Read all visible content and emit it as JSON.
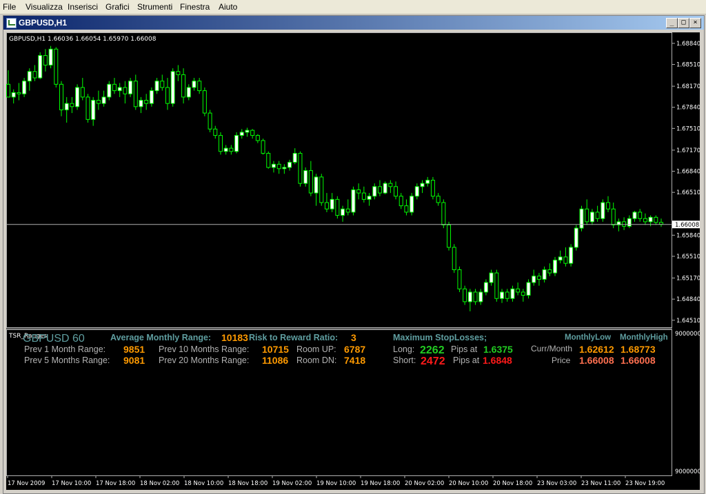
{
  "menu": {
    "items": [
      "File",
      "Visualizza",
      "Inserisci",
      "Grafici",
      "Strumenti",
      "Finestra",
      "Aiuto"
    ]
  },
  "window": {
    "title": "GBPUSD,H1",
    "btn_min": "_",
    "btn_max": "□",
    "btn_close": "×"
  },
  "chart": {
    "header": "GBPUSD,H1  1.66036 1.66054 1.65970 1.66008",
    "current_price_label": "1.66008",
    "price_ticks": [
      "1.68840",
      "1.68510",
      "1.68170",
      "1.67840",
      "1.67510",
      "1.67170",
      "1.66840",
      "1.66510",
      "1.65840",
      "1.65510",
      "1.65170",
      "1.64840",
      "1.64510"
    ],
    "time_ticks": [
      "17 Nov 2009",
      "17 Nov 10:00",
      "17 Nov 18:00",
      "18 Nov 02:00",
      "18 Nov 10:00",
      "18 Nov 18:00",
      "19 Nov 02:00",
      "19 Nov 10:00",
      "19 Nov 18:00",
      "20 Nov 02:00",
      "20 Nov 10:00",
      "20 Nov 18:00",
      "23 Nov 03:00",
      "23 Nov 11:00",
      "23 Nov 19:00"
    ],
    "sub_ticks": [
      "9000000",
      "9000000"
    ],
    "colors": {
      "bg": "#000000",
      "bull": "#ffffff",
      "bear": "#000000",
      "wick": "#00ff00",
      "grid": "#b0b0b0"
    }
  },
  "indicator": {
    "name": "TSR_Ranges",
    "pair_label": "GBPUSD 60",
    "avg_label": "Average Monthly Range:",
    "avg_value": "10183",
    "rr_label": "Risk to Reward Ratio:",
    "rr_value": "3",
    "prev1_label": "Prev 1 Month Range:",
    "prev1_value": "9851",
    "prev5_label": "Prev 5 Months Range:",
    "prev5_value": "9081",
    "prev10_label": "Prev 10 Months Range:",
    "prev10_value": "10715",
    "prev20_label": "Prev 20 Months Range:",
    "prev20_value": "11086",
    "roomup_label": "Room UP:",
    "roomup_value": "6787",
    "roomdn_label": "Room DN:",
    "roomdn_value": "7418",
    "maxsl_label": "Maximum StopLosses;",
    "long_label": "Long:",
    "long_value": "2262",
    "long_pips": "Pips at",
    "long_price": "1.6375",
    "short_label": "Short:",
    "short_value": "2472",
    "short_pips": "Pips at",
    "short_price": "1.6848",
    "mlow_label": "MonthlyLow",
    "mhigh_label": "MonthlyHigh",
    "currmonth_label": "Curr/Month",
    "currmonth_low": "1.62612",
    "currmonth_high": "1.68773",
    "price_label": "Price",
    "price_low": "1.66008",
    "price_high": "1.66008",
    "colors": {
      "orange": "#ff9a00",
      "green": "#22cc22",
      "red": "#ff1a1a",
      "teal": "#5f9ea0",
      "salmon": "#ff7050"
    }
  },
  "chart_data": {
    "type": "candlestick",
    "symbol": "GBPUSD,H1",
    "ylim": [
      1.644,
      1.6899
    ],
    "candles": [
      [
        1.682,
        1.6842,
        1.68,
        1.68
      ],
      [
        1.68,
        1.6812,
        1.679,
        1.6807
      ],
      [
        1.6807,
        1.6822,
        1.6795,
        1.6805
      ],
      [
        1.6805,
        1.683,
        1.68,
        1.6825
      ],
      [
        1.6825,
        1.6845,
        1.681,
        1.684
      ],
      [
        1.684,
        1.685,
        1.6825,
        1.683
      ],
      [
        1.683,
        1.687,
        1.6828,
        1.6865
      ],
      [
        1.6865,
        1.6875,
        1.684,
        1.685
      ],
      [
        1.685,
        1.688,
        1.6845,
        1.6875
      ],
      [
        1.6875,
        1.6878,
        1.6815,
        1.682
      ],
      [
        1.682,
        1.6825,
        1.677,
        1.678
      ],
      [
        1.678,
        1.68,
        1.676,
        1.679
      ],
      [
        1.679,
        1.68,
        1.6775,
        1.6785
      ],
      [
        1.6785,
        1.682,
        1.678,
        1.6815
      ],
      [
        1.6815,
        1.683,
        1.6795,
        1.68
      ],
      [
        1.68,
        1.6805,
        1.676,
        1.6765
      ],
      [
        1.6765,
        1.68,
        1.6755,
        1.6795
      ],
      [
        1.6795,
        1.681,
        1.678,
        1.679
      ],
      [
        1.679,
        1.681,
        1.6785,
        1.68
      ],
      [
        1.68,
        1.6825,
        1.6795,
        1.682
      ],
      [
        1.682,
        1.683,
        1.6805,
        1.681
      ],
      [
        1.681,
        1.6822,
        1.68,
        1.6815
      ],
      [
        1.6815,
        1.6825,
        1.679,
        1.6805
      ],
      [
        1.6805,
        1.683,
        1.68,
        1.6825
      ],
      [
        1.6825,
        1.6835,
        1.678,
        1.6785
      ],
      [
        1.6785,
        1.68,
        1.6775,
        1.6795
      ],
      [
        1.6795,
        1.6805,
        1.678,
        1.679
      ],
      [
        1.679,
        1.6815,
        1.6785,
        1.681
      ],
      [
        1.681,
        1.683,
        1.6805,
        1.6825
      ],
      [
        1.6825,
        1.6835,
        1.681,
        1.6815
      ],
      [
        1.6815,
        1.683,
        1.678,
        1.679
      ],
      [
        1.679,
        1.6845,
        1.6785,
        1.684
      ],
      [
        1.684,
        1.685,
        1.6825,
        1.6835
      ],
      [
        1.6835,
        1.6845,
        1.679,
        1.68
      ],
      [
        1.68,
        1.682,
        1.6795,
        1.6815
      ],
      [
        1.6815,
        1.683,
        1.681,
        1.6825
      ],
      [
        1.6825,
        1.683,
        1.6805,
        1.681
      ],
      [
        1.681,
        1.6815,
        1.677,
        1.6775
      ],
      [
        1.6775,
        1.678,
        1.6745,
        1.675
      ],
      [
        1.675,
        1.6755,
        1.6735,
        1.674
      ],
      [
        1.674,
        1.6745,
        1.671,
        1.6715
      ],
      [
        1.6715,
        1.6725,
        1.671,
        1.672
      ],
      [
        1.672,
        1.6725,
        1.671,
        1.6715
      ],
      [
        1.6715,
        1.6745,
        1.6712,
        1.674
      ],
      [
        1.674,
        1.675,
        1.6735,
        1.6745
      ],
      [
        1.6745,
        1.6752,
        1.6738,
        1.6748
      ],
      [
        1.6748,
        1.675,
        1.6735,
        1.674
      ],
      [
        1.674,
        1.6742,
        1.6728,
        1.6732
      ],
      [
        1.6732,
        1.6735,
        1.671,
        1.6712
      ],
      [
        1.6712,
        1.6715,
        1.6688,
        1.669
      ],
      [
        1.669,
        1.67,
        1.6682,
        1.6695
      ],
      [
        1.6695,
        1.67,
        1.668,
        1.6688
      ],
      [
        1.6688,
        1.6695,
        1.668,
        1.669
      ],
      [
        1.669,
        1.6702,
        1.6685,
        1.6698
      ],
      [
        1.6698,
        1.672,
        1.6695,
        1.6712
      ],
      [
        1.6712,
        1.6715,
        1.666,
        1.6665
      ],
      [
        1.6665,
        1.669,
        1.666,
        1.6685
      ],
      [
        1.6685,
        1.67,
        1.6645,
        1.665
      ],
      [
        1.665,
        1.668,
        1.663,
        1.6675
      ],
      [
        1.6675,
        1.668,
        1.663,
        1.6635
      ],
      [
        1.6635,
        1.665,
        1.662,
        1.6625
      ],
      [
        1.6625,
        1.665,
        1.662,
        1.664
      ],
      [
        1.664,
        1.6645,
        1.661,
        1.6615
      ],
      [
        1.6615,
        1.663,
        1.6605,
        1.6625
      ],
      [
        1.6625,
        1.664,
        1.6615,
        1.662
      ],
      [
        1.662,
        1.666,
        1.6615,
        1.6655
      ],
      [
        1.6655,
        1.6665,
        1.664,
        1.665
      ],
      [
        1.665,
        1.666,
        1.6635,
        1.664
      ],
      [
        1.664,
        1.665,
        1.663,
        1.6645
      ],
      [
        1.6645,
        1.6665,
        1.664,
        1.666
      ],
      [
        1.666,
        1.667,
        1.6645,
        1.665
      ],
      [
        1.665,
        1.6668,
        1.6648,
        1.6665
      ],
      [
        1.6665,
        1.667,
        1.665,
        1.666
      ],
      [
        1.666,
        1.6668,
        1.664,
        1.6645
      ],
      [
        1.6645,
        1.665,
        1.6625,
        1.663
      ],
      [
        1.663,
        1.664,
        1.6615,
        1.662
      ],
      [
        1.662,
        1.665,
        1.6615,
        1.6645
      ],
      [
        1.6645,
        1.6665,
        1.664,
        1.666
      ],
      [
        1.666,
        1.667,
        1.665,
        1.6665
      ],
      [
        1.6665,
        1.6675,
        1.666,
        1.667
      ],
      [
        1.667,
        1.6675,
        1.664,
        1.6645
      ],
      [
        1.6645,
        1.665,
        1.663,
        1.6635
      ],
      [
        1.6635,
        1.664,
        1.6595,
        1.66
      ],
      [
        1.66,
        1.6605,
        1.656,
        1.6565
      ],
      [
        1.6565,
        1.657,
        1.6525,
        1.653
      ],
      [
        1.653,
        1.6535,
        1.6495,
        1.65
      ],
      [
        1.65,
        1.6505,
        1.6475,
        1.648
      ],
      [
        1.648,
        1.65,
        1.6465,
        1.6495
      ],
      [
        1.6495,
        1.65,
        1.6475,
        1.648
      ],
      [
        1.648,
        1.65,
        1.6475,
        1.6495
      ],
      [
        1.6495,
        1.6515,
        1.649,
        1.651
      ],
      [
        1.651,
        1.653,
        1.6505,
        1.6525
      ],
      [
        1.6525,
        1.653,
        1.648,
        1.6485
      ],
      [
        1.6485,
        1.65,
        1.6478,
        1.6495
      ],
      [
        1.6495,
        1.65,
        1.648,
        1.6485
      ],
      [
        1.6485,
        1.6505,
        1.648,
        1.65
      ],
      [
        1.65,
        1.651,
        1.649,
        1.6495
      ],
      [
        1.6495,
        1.65,
        1.648,
        1.649
      ],
      [
        1.649,
        1.6515,
        1.6485,
        1.651
      ],
      [
        1.651,
        1.653,
        1.6505,
        1.652
      ],
      [
        1.652,
        1.6525,
        1.6505,
        1.6515
      ],
      [
        1.6515,
        1.6535,
        1.651,
        1.653
      ],
      [
        1.653,
        1.654,
        1.652,
        1.6525
      ],
      [
        1.6525,
        1.655,
        1.652,
        1.6545
      ],
      [
        1.6545,
        1.656,
        1.654,
        1.655
      ],
      [
        1.655,
        1.6565,
        1.6535,
        1.654
      ],
      [
        1.654,
        1.657,
        1.6535,
        1.6565
      ],
      [
        1.6565,
        1.66,
        1.656,
        1.6595
      ],
      [
        1.6595,
        1.663,
        1.659,
        1.6625
      ],
      [
        1.6625,
        1.664,
        1.66,
        1.6605
      ],
      [
        1.6605,
        1.6625,
        1.66,
        1.662
      ],
      [
        1.662,
        1.663,
        1.6605,
        1.661
      ],
      [
        1.661,
        1.664,
        1.6605,
        1.6635
      ],
      [
        1.6635,
        1.6645,
        1.662,
        1.6625
      ],
      [
        1.6625,
        1.6635,
        1.6595,
        1.66
      ],
      [
        1.66,
        1.661,
        1.659,
        1.6605
      ],
      [
        1.6605,
        1.6612,
        1.6592,
        1.6598
      ],
      [
        1.6598,
        1.6615,
        1.6595,
        1.661
      ],
      [
        1.661,
        1.6622,
        1.6605,
        1.662
      ],
      [
        1.662,
        1.6625,
        1.6605,
        1.661
      ],
      [
        1.661,
        1.6618,
        1.66,
        1.6605
      ],
      [
        1.6605,
        1.6615,
        1.6598,
        1.6612
      ],
      [
        1.6612,
        1.6615,
        1.66,
        1.6604
      ],
      [
        1.6604,
        1.661,
        1.6597,
        1.6601
      ]
    ],
    "last_price": 1.66008,
    "time_labels": [
      "17 Nov 2009",
      "17 Nov 10:00",
      "17 Nov 18:00",
      "18 Nov 02:00",
      "18 Nov 10:00",
      "18 Nov 18:00",
      "19 Nov 02:00",
      "19 Nov 10:00",
      "19 Nov 18:00",
      "20 Nov 02:00",
      "20 Nov 10:00",
      "20 Nov 18:00",
      "23 Nov 03:00",
      "23 Nov 11:00",
      "23 Nov 19:00"
    ],
    "price_labels": [
      "1.68840",
      "1.68510",
      "1.68170",
      "1.67840",
      "1.67510",
      "1.67170",
      "1.66840",
      "1.66510",
      "1.65840",
      "1.65510",
      "1.65170",
      "1.64840",
      "1.64510"
    ]
  }
}
